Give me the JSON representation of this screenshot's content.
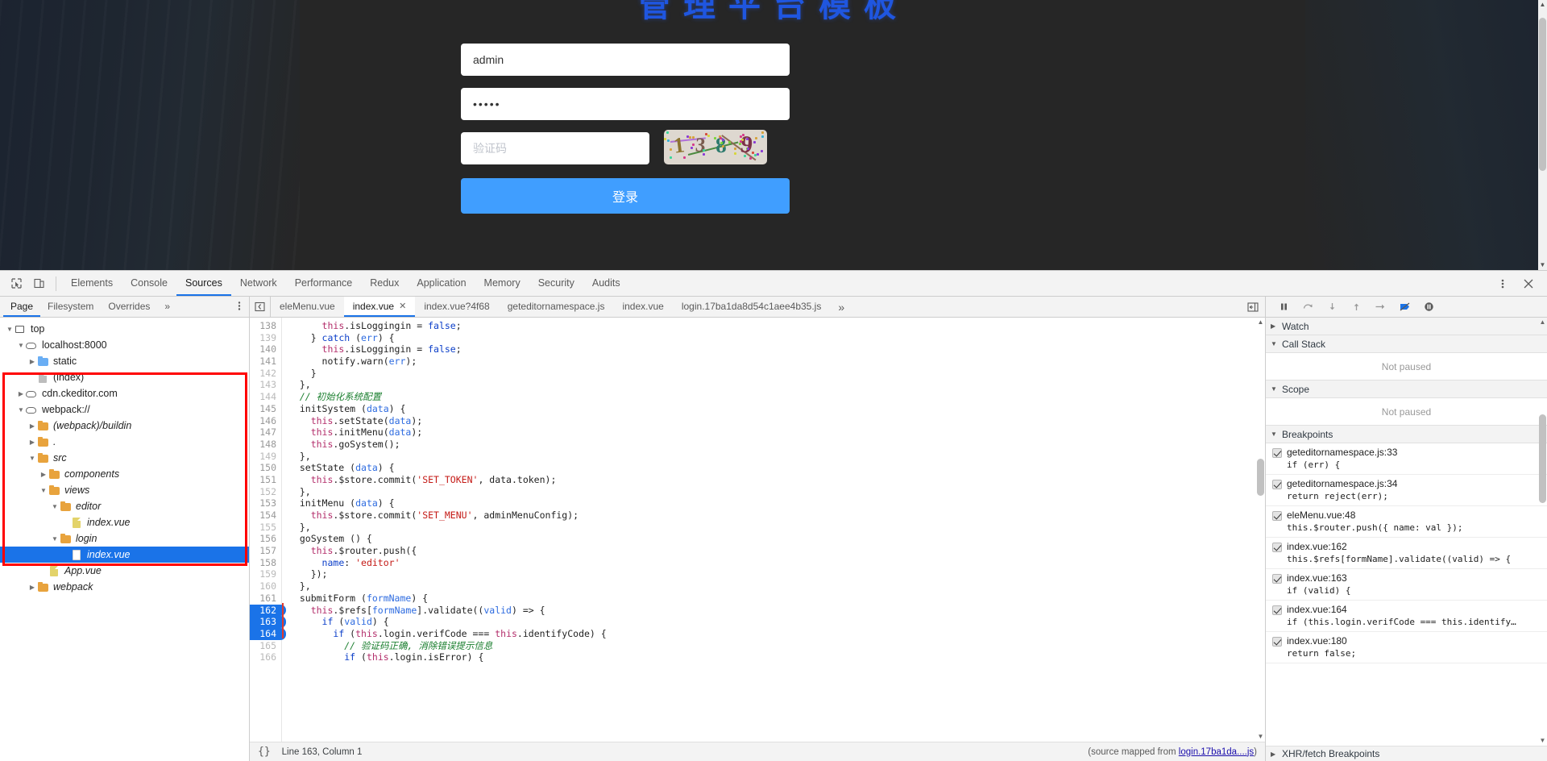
{
  "app": {
    "title": "管理平台模板",
    "username_value": "admin",
    "username_placeholder": "",
    "password_value": "•••••",
    "verifcode_placeholder": "验证码",
    "captcha_digits": [
      "1",
      "3",
      "8",
      "9"
    ],
    "login_button": "登录"
  },
  "devtools": {
    "panel_tabs": [
      {
        "label": "Elements",
        "active": false
      },
      {
        "label": "Console",
        "active": false
      },
      {
        "label": "Sources",
        "active": true
      },
      {
        "label": "Network",
        "active": false
      },
      {
        "label": "Performance",
        "active": false
      },
      {
        "label": "Redux",
        "active": false
      },
      {
        "label": "Application",
        "active": false
      },
      {
        "label": "Memory",
        "active": false
      },
      {
        "label": "Security",
        "active": false
      },
      {
        "label": "Audits",
        "active": false
      }
    ],
    "inspect_icon": "inspect-element-icon",
    "device_icon": "device-toolbar-icon",
    "more_icon": "more-options-icon",
    "close_icon": "close-devtools-icon"
  },
  "navigator": {
    "tabs": [
      {
        "label": "Page",
        "active": true
      },
      {
        "label": "Filesystem",
        "active": false
      },
      {
        "label": "Overrides",
        "active": false
      }
    ],
    "more_label": "»",
    "menu_icon": "kebab-menu-icon",
    "tree": [
      {
        "label": "top",
        "indent": 0,
        "twisty": "open",
        "icon": "frame",
        "italic": false,
        "selected": false
      },
      {
        "label": "localhost:8000",
        "indent": 1,
        "twisty": "open",
        "icon": "cloud",
        "italic": false,
        "selected": false
      },
      {
        "label": "static",
        "indent": 2,
        "twisty": "close",
        "icon": "folder-blue",
        "italic": false,
        "selected": false
      },
      {
        "label": "(index)",
        "indent": 2,
        "twisty": "none",
        "icon": "doc-gray",
        "italic": false,
        "selected": false
      },
      {
        "label": "cdn.ckeditor.com",
        "indent": 1,
        "twisty": "close",
        "icon": "cloud",
        "italic": false,
        "selected": false
      },
      {
        "label": "webpack://",
        "indent": 1,
        "twisty": "open",
        "icon": "cloud",
        "italic": false,
        "selected": false
      },
      {
        "label": "(webpack)/buildin",
        "indent": 2,
        "twisty": "close",
        "icon": "folder",
        "italic": true,
        "selected": false
      },
      {
        "label": ".",
        "indent": 2,
        "twisty": "close",
        "icon": "folder",
        "italic": true,
        "selected": false
      },
      {
        "label": "src",
        "indent": 2,
        "twisty": "open",
        "icon": "folder",
        "italic": true,
        "selected": false
      },
      {
        "label": "components",
        "indent": 3,
        "twisty": "close",
        "icon": "folder",
        "italic": true,
        "selected": false
      },
      {
        "label": "views",
        "indent": 3,
        "twisty": "open",
        "icon": "folder",
        "italic": true,
        "selected": false
      },
      {
        "label": "editor",
        "indent": 4,
        "twisty": "open",
        "icon": "folder",
        "italic": true,
        "selected": false
      },
      {
        "label": "index.vue",
        "indent": 5,
        "twisty": "none",
        "icon": "doc-yellow",
        "italic": true,
        "selected": false
      },
      {
        "label": "login",
        "indent": 4,
        "twisty": "open",
        "icon": "folder",
        "italic": true,
        "selected": false
      },
      {
        "label": "index.vue",
        "indent": 5,
        "twisty": "none",
        "icon": "doc-white",
        "italic": true,
        "selected": true
      },
      {
        "label": "App.vue",
        "indent": 3,
        "twisty": "none",
        "icon": "doc-yellow",
        "italic": true,
        "selected": false
      },
      {
        "label": "webpack",
        "indent": 2,
        "twisty": "close",
        "icon": "folder",
        "italic": true,
        "selected": false
      }
    ]
  },
  "editor": {
    "collapse_icon": "collapse-tabs-icon",
    "tabs": [
      {
        "label": "eleMenu.vue",
        "active": false,
        "closable": false
      },
      {
        "label": "index.vue",
        "active": true,
        "closable": true
      },
      {
        "label": "index.vue?4f68",
        "active": false,
        "closable": false
      },
      {
        "label": "geteditornamespace.js",
        "active": false,
        "closable": false
      },
      {
        "label": "index.vue",
        "active": false,
        "closable": false
      },
      {
        "label": "login.17ba1da8d54c1aee4b35.js",
        "active": false,
        "closable": false
      }
    ],
    "more_tabs_label": "»",
    "show_navigator_icon": "show-pane-icon",
    "lines": [
      {
        "n": 138,
        "dim": false,
        "bp": false,
        "code": "      this.isLoggingin = false;"
      },
      {
        "n": 139,
        "dim": true,
        "bp": false,
        "code": "    } catch (err) {"
      },
      {
        "n": 140,
        "dim": false,
        "bp": false,
        "code": "      this.isLoggingin = false;"
      },
      {
        "n": 141,
        "dim": false,
        "bp": false,
        "code": "      notify.warn(err);"
      },
      {
        "n": 142,
        "dim": true,
        "bp": false,
        "code": "    }"
      },
      {
        "n": 143,
        "dim": true,
        "bp": false,
        "code": "  },"
      },
      {
        "n": 144,
        "dim": true,
        "bp": false,
        "code": "  // 初始化系统配置"
      },
      {
        "n": 145,
        "dim": false,
        "bp": false,
        "code": "  initSystem (data) {"
      },
      {
        "n": 146,
        "dim": false,
        "bp": false,
        "code": "    this.setState(data);"
      },
      {
        "n": 147,
        "dim": false,
        "bp": false,
        "code": "    this.initMenu(data);"
      },
      {
        "n": 148,
        "dim": false,
        "bp": false,
        "code": "    this.goSystem();"
      },
      {
        "n": 149,
        "dim": true,
        "bp": false,
        "code": "  },"
      },
      {
        "n": 150,
        "dim": false,
        "bp": false,
        "code": "  setState (data) {"
      },
      {
        "n": 151,
        "dim": false,
        "bp": false,
        "code": "    this.$store.commit('SET_TOKEN', data.token);"
      },
      {
        "n": 152,
        "dim": true,
        "bp": false,
        "code": "  },"
      },
      {
        "n": 153,
        "dim": false,
        "bp": false,
        "code": "  initMenu (data) {"
      },
      {
        "n": 154,
        "dim": false,
        "bp": false,
        "code": "    this.$store.commit('SET_MENU', adminMenuConfig);"
      },
      {
        "n": 155,
        "dim": true,
        "bp": false,
        "code": "  },"
      },
      {
        "n": 156,
        "dim": false,
        "bp": false,
        "code": "  goSystem () {"
      },
      {
        "n": 157,
        "dim": false,
        "bp": false,
        "code": "    this.$router.push({"
      },
      {
        "n": 158,
        "dim": false,
        "bp": false,
        "code": "      name: 'editor'"
      },
      {
        "n": 159,
        "dim": true,
        "bp": false,
        "code": "    });"
      },
      {
        "n": 160,
        "dim": true,
        "bp": false,
        "code": "  },"
      },
      {
        "n": 161,
        "dim": false,
        "bp": false,
        "code": "  submitForm (formName) {"
      },
      {
        "n": 162,
        "dim": false,
        "bp": true,
        "code": "    this.$refs[formName].validate((valid) => {"
      },
      {
        "n": 163,
        "dim": false,
        "bp": true,
        "code": "      if (valid) {"
      },
      {
        "n": 164,
        "dim": false,
        "bp": true,
        "code": "        if (this.login.verifCode === this.identifyCode) {"
      },
      {
        "n": 165,
        "dim": true,
        "bp": false,
        "code": "          // 验证码正确, 消除错误提示信息"
      },
      {
        "n": 166,
        "dim": true,
        "bp": false,
        "code": "          if (this.login.isError) {"
      }
    ],
    "status_pretty_icon": "{}",
    "status_position": "Line 163, Column 1",
    "status_source_prefix": "(source mapped from ",
    "status_source_link": "login.17ba1da....js",
    "status_source_suffix": ")"
  },
  "debugger": {
    "toolbar": [
      {
        "name": "resume-script-execution",
        "icon": "pause-icon"
      },
      {
        "name": "step-over-next-function-call",
        "icon": "step-over-icon"
      },
      {
        "name": "step-into-next-function-call",
        "icon": "step-into-icon"
      },
      {
        "name": "step-out-of-current-function",
        "icon": "step-out-icon"
      },
      {
        "name": "step",
        "icon": "step-icon"
      },
      {
        "name": "deactivate-breakpoints",
        "icon": "deactivate-breakpoints-icon"
      },
      {
        "name": "pause-on-exceptions",
        "icon": "pause-on-exceptions-icon"
      }
    ],
    "sections": [
      {
        "title": "Watch",
        "open": false
      },
      {
        "title": "Call Stack",
        "open": true,
        "empty_text": "Not paused"
      },
      {
        "title": "Scope",
        "open": true,
        "empty_text": "Not paused"
      },
      {
        "title": "Breakpoints",
        "open": true
      }
    ],
    "breakpoints": [
      {
        "checked": true,
        "location": "geteditornamespace.js:33",
        "code": "if (err) {"
      },
      {
        "checked": true,
        "location": "geteditornamespace.js:34",
        "code": "return reject(err);"
      },
      {
        "checked": true,
        "location": "eleMenu.vue:48",
        "code": "this.$router.push({ name: val });"
      },
      {
        "checked": true,
        "location": "index.vue:162",
        "code": "this.$refs[formName].validate((valid) => {"
      },
      {
        "checked": true,
        "location": "index.vue:163",
        "code": "if (valid) {"
      },
      {
        "checked": true,
        "location": "index.vue:164",
        "code": "if (this.login.verifCode === this.identify…"
      },
      {
        "checked": true,
        "location": "index.vue:180",
        "code": "return false;"
      }
    ],
    "xhr_section": "XHR/fetch Breakpoints"
  },
  "colors": {
    "accent": "#1a73e8",
    "login_button": "#409eff",
    "highlight_box": "#ff0000",
    "title": "#1f56e0"
  }
}
